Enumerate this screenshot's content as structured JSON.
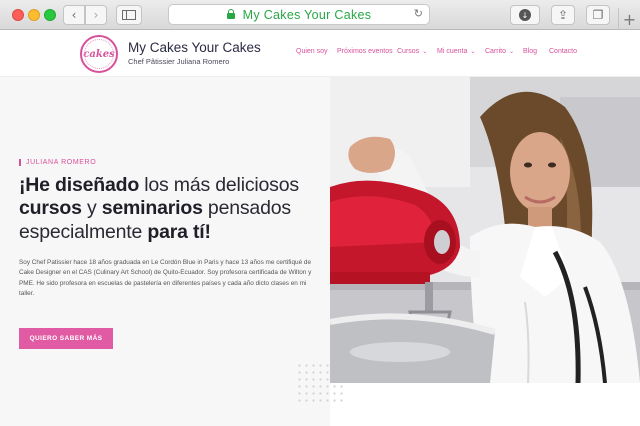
{
  "browser": {
    "url": "My Cakes Your Cakes",
    "back_glyph": "‹",
    "forward_glyph": "›",
    "reload_glyph": "↻",
    "newtab_glyph": "+",
    "download_glyph": "↓",
    "share_glyph": "⇪",
    "tabs_glyph": "❐"
  },
  "site": {
    "logo_text": "cakes",
    "brand_name": "My Cakes Your Cakes",
    "brand_subtitle": "Chef Pâtissier Juliana Romero",
    "accent_color": "#d9509b",
    "menu": [
      {
        "label": "Quien soy",
        "has_dropdown": false
      },
      {
        "label": "Próximos eventos",
        "has_dropdown": false
      },
      {
        "label": "Cursos",
        "has_dropdown": true
      },
      {
        "label": "Mi cuenta",
        "has_dropdown": true
      },
      {
        "label": "Carrito",
        "has_dropdown": true
      },
      {
        "label": "Blog",
        "has_dropdown": false
      },
      {
        "label": "Contacto",
        "has_dropdown": false
      }
    ],
    "caret_glyph": "⌄"
  },
  "hero": {
    "eyebrow": "JULIANA ROMERO",
    "headline": {
      "p1": "¡He diseñado",
      "p2": " los más deliciosos ",
      "p3": "cursos",
      "p4": " y ",
      "p5": "seminarios",
      "p6": " pensados especialmente ",
      "p7": "para tí!"
    },
    "body": "Soy Chef Patissier hace 18 años graduada en Le Cordón Blue in Paris y hace 13 años me certifiqué de Cake Designer en el CAS (Culinary Art School) de Quito-Ecuador. Soy profesora certificada de Wilton y PME. He sido profesora en escuelas de pastelería en diferentes países y cada año dicto clases en mi taller.",
    "cta_label": "QUIERO SABER MÁS",
    "cta_color": "#e05ba3"
  }
}
